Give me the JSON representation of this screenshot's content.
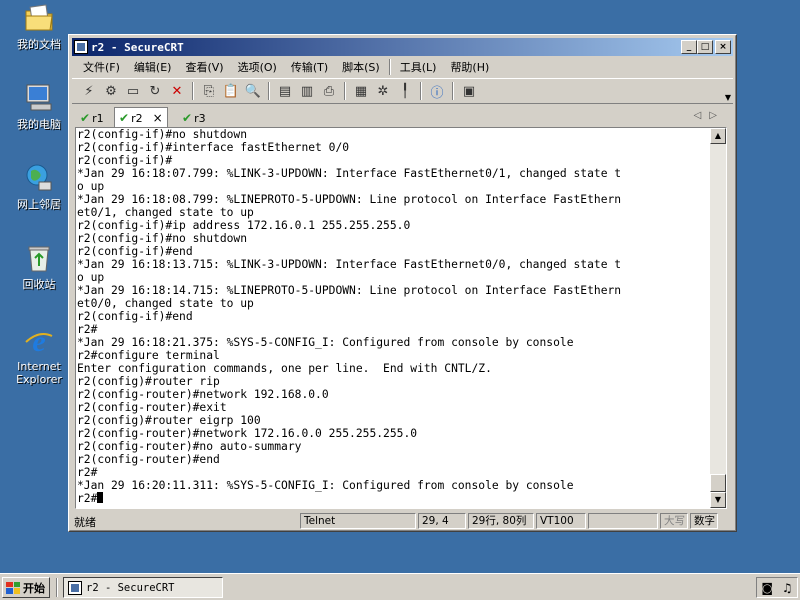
{
  "desktop": {
    "icons": [
      {
        "label": "我的文档",
        "icon": "my-documents-icon"
      },
      {
        "label": "我的电脑",
        "icon": "my-computer-icon"
      },
      {
        "label": "网上邻居",
        "icon": "network-places-icon"
      },
      {
        "label": "回收站",
        "icon": "recycle-bin-icon"
      },
      {
        "label": "Internet Explorer",
        "icon": "internet-explorer-icon"
      }
    ]
  },
  "window": {
    "title": "r2 - SecureCRT",
    "menus": [
      "文件(F)",
      "编辑(E)",
      "查看(V)",
      "选项(O)",
      "传输(T)",
      "脚本(S)",
      "工具(L)",
      "帮助(H)"
    ],
    "tabs": [
      {
        "label": "r1",
        "active": false
      },
      {
        "label": "r2",
        "active": true,
        "close": "×"
      },
      {
        "label": "r3",
        "active": false
      }
    ],
    "terminal_lines": [
      "r2(config-if)#no shutdown",
      "r2(config-if)#interface fastEthernet 0/0",
      "r2(config-if)#",
      "*Jan 29 16:18:07.799: %LINK-3-UPDOWN: Interface FastEthernet0/1, changed state t",
      "o up",
      "*Jan 29 16:18:08.799: %LINEPROTO-5-UPDOWN: Line protocol on Interface FastEthern",
      "et0/1, changed state to up",
      "r2(config-if)#ip address 172.16.0.1 255.255.255.0",
      "r2(config-if)#no shutdown",
      "r2(config-if)#end",
      "*Jan 29 16:18:13.715: %LINK-3-UPDOWN: Interface FastEthernet0/0, changed state t",
      "o up",
      "*Jan 29 16:18:14.715: %LINEPROTO-5-UPDOWN: Line protocol on Interface FastEthern",
      "et0/0, changed state to up",
      "r2(config-if)#end",
      "r2#",
      "*Jan 29 16:18:21.375: %SYS-5-CONFIG_I: Configured from console by console",
      "r2#configure terminal",
      "Enter configuration commands, one per line.  End with CNTL/Z.",
      "r2(config)#router rip",
      "r2(config-router)#network 192.168.0.0",
      "r2(config-router)#exit",
      "r2(config)#router eigrp 100",
      "r2(config-router)#network 172.16.0.0 255.255.255.0",
      "r2(config-router)#no auto-summary",
      "r2(config-router)#end",
      "r2#",
      "*Jan 29 16:20:11.311: %SYS-5-CONFIG_I: Configured from console by console"
    ],
    "prompt": "r2#",
    "status": {
      "ready": "就绪",
      "protocol": "Telnet",
      "cursor_pos": "29,  4",
      "rows_cols": "29行, 80列",
      "emulation": "VT100",
      "caps": "大写",
      "num": "数字"
    }
  },
  "taskbar": {
    "start_label": "开始",
    "task_title": "r2 - SecureCRT"
  },
  "colors": {
    "desktop": "#3a6ea5",
    "title_start": "#0a246a",
    "title_end": "#a6caf0",
    "tab_check": "#2a9a2a"
  }
}
